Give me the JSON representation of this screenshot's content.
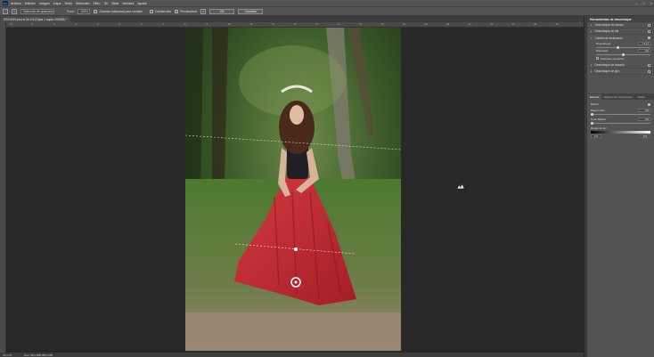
{
  "menubar": {
    "logo": "Ps",
    "items": [
      "Archivo",
      "Edición",
      "Imagen",
      "Capa",
      "Texto",
      "Selección",
      "Filtro",
      "3D",
      "Vista",
      "Ventana",
      "Ayuda"
    ],
    "window_controls": [
      "–",
      "□",
      "×"
    ]
  },
  "options": {
    "selection_label": "Selección de guardado",
    "focus_label": "Foco:",
    "focus_value": "100%",
    "save_masks_label": "Guardar máscaras para canales",
    "high_quality_label": "Calidad alta",
    "preview_label": "Previsualizar",
    "ok_label": "OK",
    "cancel_label": "Cancelar"
  },
  "document": {
    "tab_label": "DSC4019.psd al 34,1% (Capa 1 copia, RGB/8) *"
  },
  "ruler": {
    "h_ticks": [
      "10",
      "8",
      "6",
      "4",
      "2",
      "0",
      "2",
      "4",
      "6",
      "8",
      "10",
      "12",
      "14",
      "16",
      "18",
      "20",
      "22",
      "24",
      "26",
      "28",
      "30",
      "32",
      "34",
      "36",
      "38",
      "40"
    ]
  },
  "status": {
    "zoom": "34,17%",
    "doc": "Doc: 28,1 MB/185,9 MB"
  },
  "blur_panel": {
    "title": "Herramientas de desenfoque",
    "items": [
      {
        "label": "Desenfoque de campo",
        "checked": false
      },
      {
        "label": "Desenfoque de iris",
        "checked": false
      },
      {
        "label": "Cambio de inclinación",
        "checked": true
      },
      {
        "label": "Desenfoque de trazado",
        "checked": false
      },
      {
        "label": "Desenfoque de giro",
        "checked": false
      }
    ],
    "tilt": {
      "blur_label": "Desenfoque:",
      "blur_value": "15 px",
      "blur_level": 0.4,
      "distortion_label": "Distorsión:",
      "distortion_value": "0%",
      "distortion_level": 0.5,
      "symmetric_label": "Distorsión simétrica"
    }
  },
  "effects_panel": {
    "tabs": [
      "Efectos",
      "Efectos de movimiento",
      "Ruido"
    ],
    "bokeh_label": "Bokeh",
    "light_bokeh_label": "Bokeh claro:",
    "light_bokeh_value": "0%",
    "light_bokeh_level": 0,
    "color_bokeh_label": "Color Bokeh:",
    "color_bokeh_value": "0%",
    "color_bokeh_level": 0,
    "light_range_label": "Rango de luz:",
    "light_range_min": "191",
    "light_range_max": "255"
  },
  "colors": {
    "skirt": "#c0282e",
    "foliage": "#3f6a2a",
    "panel": "#535353"
  }
}
